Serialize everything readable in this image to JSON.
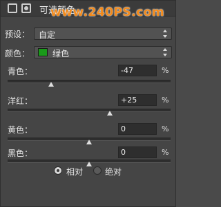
{
  "title_bar": {
    "title": "可选颜色",
    "watermark": "www.240PS.com"
  },
  "preset": {
    "label": "预设：",
    "value": "自定"
  },
  "colors": {
    "label": "颜色：",
    "value": "绿色",
    "swatch_color": "#1a9a1a"
  },
  "sliders": [
    {
      "label": "青色：",
      "value": "-47",
      "unit": "%",
      "level": -47
    },
    {
      "label": "洋红：",
      "value": "+25",
      "unit": "%",
      "level": 25
    },
    {
      "label": "黄色：",
      "value": "0",
      "unit": "%",
      "level": 0
    },
    {
      "label": "黑色：",
      "value": "0",
      "unit": "%",
      "level": 0
    }
  ],
  "method": {
    "options": [
      "相对",
      "绝对"
    ],
    "selected": "相对"
  }
}
